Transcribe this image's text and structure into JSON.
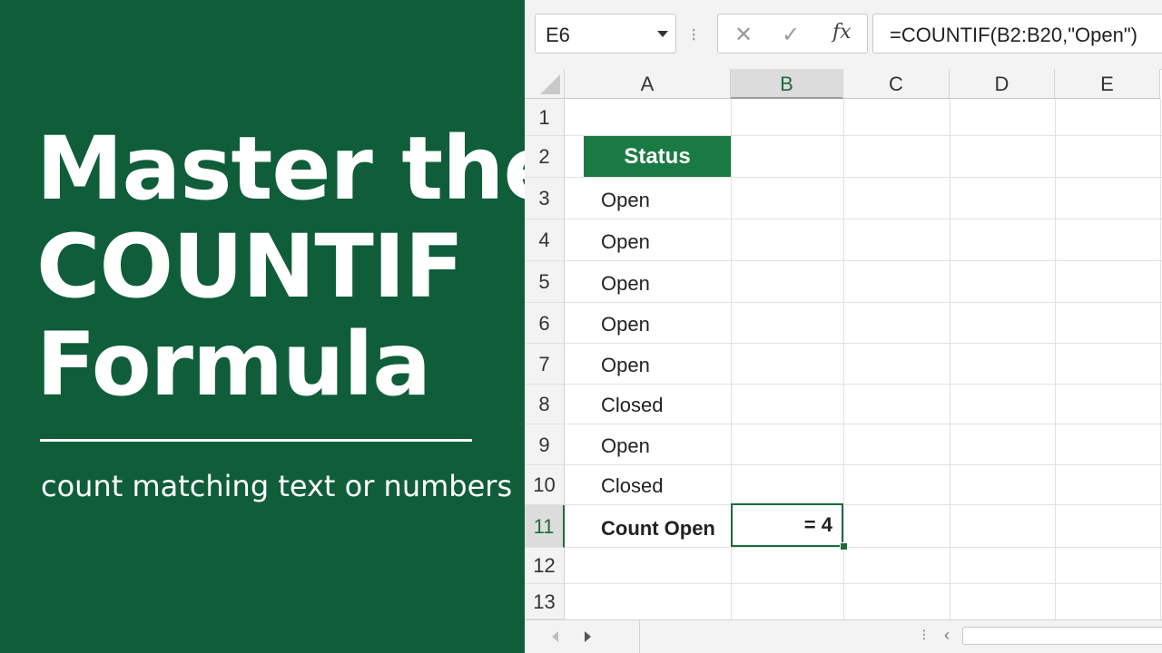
{
  "promo": {
    "title_lines": [
      "Master the",
      "COUNTIF",
      "Formula"
    ],
    "subtitle": "count matching text or numbers"
  },
  "formula_bar": {
    "name_box": "E6",
    "separator": "⁝",
    "cancel_icon": "✕",
    "enter_icon": "✓",
    "fx_label": "fx",
    "formula": "=COUNTIF(B2:B20,\"Open\")"
  },
  "columns": [
    "A",
    "B",
    "C",
    "D",
    "E"
  ],
  "rows": [
    "1",
    "2",
    "3",
    "4",
    "5",
    "6",
    "7",
    "8",
    "9",
    "10",
    "11",
    "12",
    "13"
  ],
  "sheet": {
    "header": "Status",
    "statuses": [
      "Open",
      "Open",
      "Open",
      "Open",
      "Open",
      "Closed",
      "Open",
      "Closed"
    ],
    "count_label": "Count Open",
    "result": "= 4"
  },
  "bottom_bar": {
    "dots": "⁝",
    "scroll_left": "‹"
  },
  "colors": {
    "panel_green": "#0f5e39",
    "header_green": "#1a7a43",
    "selection_green": "#1a6b3c"
  }
}
